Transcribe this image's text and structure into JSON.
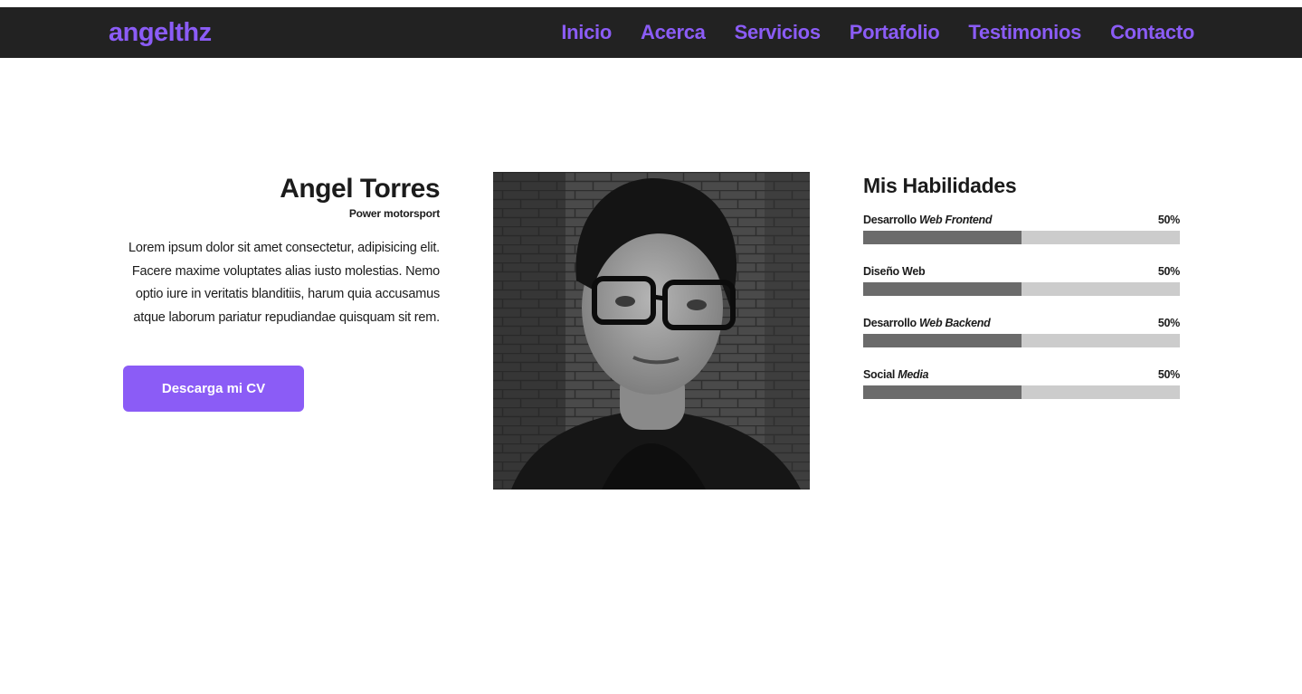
{
  "header": {
    "brand": "angelthz",
    "nav": [
      "Inicio",
      "Acerca",
      "Servicios",
      "Portafolio",
      "Testimonios",
      "Contacto"
    ]
  },
  "about": {
    "name": "Angel Torres",
    "role": "Power motorsport",
    "bio": "Lorem ipsum dolor sit amet consectetur, adipisicing elit. Facere maxime voluptates alias iusto molestias. Nemo optio iure in veritatis blanditiis, harum quia accusamus atque laborum pariatur repudiandae quisquam sit rem.",
    "cv_button": "Descarga mi CV"
  },
  "skills": {
    "title": "Mis Habilidades",
    "items": [
      {
        "label": "Desarrollo",
        "label_em": "Web Frontend",
        "percent_text": "50%",
        "percent": 50
      },
      {
        "label": "Diseño Web",
        "label_em": "",
        "percent_text": "50%",
        "percent": 50
      },
      {
        "label": "Desarrollo",
        "label_em": "Web Backend",
        "percent_text": "50%",
        "percent": 50
      },
      {
        "label": "Social",
        "label_em": "Media",
        "percent_text": "50%",
        "percent": 50
      }
    ]
  },
  "colors": {
    "accent": "#8b5cf6",
    "navbar": "#222222",
    "bar_fill": "#6b6b6b",
    "bar_track": "#cccccc"
  }
}
